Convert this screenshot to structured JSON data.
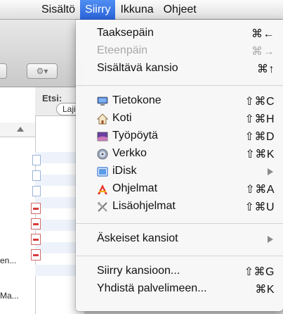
{
  "menubar": {
    "items": [
      "Sisältö",
      "Siirry",
      "Ikkuna",
      "Ohjeet"
    ],
    "active_index": 1
  },
  "background": {
    "toolbar_button": "⚙▾",
    "search_label": "Etsi:",
    "filter_button": "Laji",
    "side_items": [
      "en...",
      "Ma..."
    ]
  },
  "menu": {
    "items": [
      {
        "label": "Taaksepäin",
        "shortcut": "⌘←",
        "enabled": true
      },
      {
        "label": "Eteenpäin",
        "shortcut": "⌘→",
        "enabled": false
      },
      {
        "label": "Sisältävä kansio",
        "shortcut": "⌘↑",
        "enabled": true
      },
      {
        "label": "Tietokone",
        "shortcut": "⇧⌘C",
        "icon": "computer-icon",
        "enabled": true
      },
      {
        "label": "Koti",
        "shortcut": "⇧⌘H",
        "icon": "home-icon",
        "enabled": true
      },
      {
        "label": "Työpöytä",
        "shortcut": "⇧⌘D",
        "icon": "desktop-icon",
        "enabled": true
      },
      {
        "label": "Verkko",
        "shortcut": "⇧⌘K",
        "icon": "network-icon",
        "enabled": true
      },
      {
        "label": "iDisk",
        "submenu": true,
        "icon": "idisk-icon",
        "enabled": true
      },
      {
        "label": "Ohjelmat",
        "shortcut": "⇧⌘A",
        "icon": "applications-icon",
        "enabled": true
      },
      {
        "label": "Lisäohjelmat",
        "shortcut": "⇧⌘U",
        "icon": "utilities-icon",
        "enabled": true
      },
      {
        "label": "Äskeiset kansiot",
        "submenu": true,
        "enabled": true
      },
      {
        "label": "Siirry kansioon...",
        "shortcut": "⇧⌘G",
        "enabled": true
      },
      {
        "label": "Yhdistä palvelimeen...",
        "shortcut": "⌘K",
        "enabled": true
      }
    ]
  },
  "colors": {
    "menu_highlight": "#2f6fe0",
    "disabled_text": "#a8a8a8"
  }
}
